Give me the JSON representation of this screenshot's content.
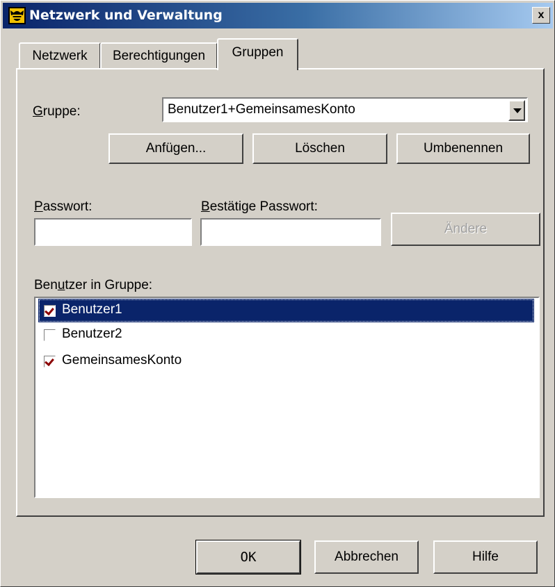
{
  "window": {
    "title": "Netzwerk und Verwaltung",
    "close_label": "x"
  },
  "tabs": [
    {
      "label": "Netzwerk",
      "active": false
    },
    {
      "label": "Berechtigungen",
      "active": false
    },
    {
      "label": "Gruppen",
      "active": true
    }
  ],
  "group": {
    "label_accel": "G",
    "label_rest": "ruppe:",
    "selected_value": "Benutzer1+GemeinsamesKonto",
    "add_button": "Anfügen...",
    "delete_button": "Löschen",
    "rename_button": "Umbenennen"
  },
  "password": {
    "label_accel": "P",
    "label_rest": "asswort:",
    "value": "",
    "confirm_label_accel": "B",
    "confirm_label_rest": "estätige Passwort:",
    "confirm_value": "",
    "change_button": "Ändere",
    "change_enabled": false
  },
  "users": {
    "label_pre": "Ben",
    "label_accel": "u",
    "label_post": "tzer in Gruppe:",
    "items": [
      {
        "label": "Benutzer1",
        "checked": true,
        "selected": true
      },
      {
        "label": "Benutzer2",
        "checked": false,
        "selected": false
      },
      {
        "label": "GemeinsamesKonto",
        "checked": true,
        "selected": false
      }
    ]
  },
  "footer": {
    "ok": "OK",
    "cancel": "Abbrechen",
    "help": "Hilfe"
  },
  "colors": {
    "face": "#d4d0c8",
    "title_start": "#0a246a",
    "title_end": "#a6caf0",
    "selection": "#0a246a",
    "check": "#8b0000"
  },
  "icons": {
    "app": "bee-app-icon",
    "close": "close-icon",
    "dropdown": "chevron-down-icon"
  }
}
